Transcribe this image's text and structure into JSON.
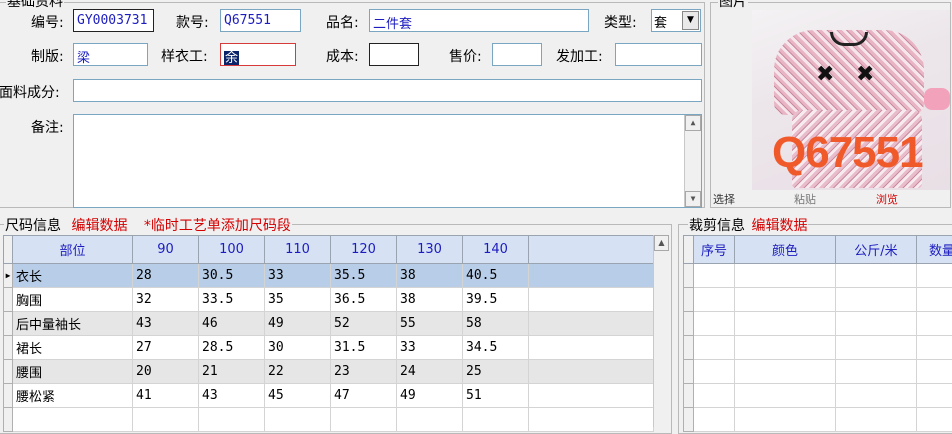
{
  "basic": {
    "section_title": "基础资料",
    "code_label": "编号:",
    "code_value": "GY0003731",
    "style_label": "款号:",
    "style_value": "Q67551",
    "name_label": "品名:",
    "name_value": "二件套",
    "type_label": "类型:",
    "type_value": "套",
    "pattern_label": "制版:",
    "pattern_value": "梁",
    "sample_label": "样衣工:",
    "sample_value": "余",
    "cost_label": "成本:",
    "cost_value": "",
    "price_label": "售价:",
    "price_value": "",
    "outsource_label": "发加工:",
    "outsource_value": "",
    "fabric_label": "面料成分:",
    "fabric_value": "",
    "remark_label": "备注:",
    "remark_value": ""
  },
  "image": {
    "section_title": "图片",
    "overlay_text": "Q67551",
    "btn_select": "选择",
    "btn_paste": "粘贴",
    "btn_browse": "浏览"
  },
  "size": {
    "title": "尺码信息",
    "edit_link": "编辑数据",
    "hint": "*临时工艺单添加尺码段",
    "headers": [
      "部位",
      "90",
      "100",
      "110",
      "120",
      "130",
      "140"
    ],
    "rows": [
      [
        "衣长",
        "28",
        "30.5",
        "33",
        "35.5",
        "38",
        "40.5"
      ],
      [
        "胸围",
        "32",
        "33.5",
        "35",
        "36.5",
        "38",
        "39.5"
      ],
      [
        "后中量袖长",
        "43",
        "46",
        "49",
        "52",
        "55",
        "58"
      ],
      [
        "裙长",
        "27",
        "28.5",
        "30",
        "31.5",
        "33",
        "34.5"
      ],
      [
        "腰围",
        "20",
        "21",
        "22",
        "23",
        "24",
        "25"
      ],
      [
        "腰松紧",
        "41",
        "43",
        "45",
        "47",
        "49",
        "51"
      ]
    ]
  },
  "cut": {
    "title": "裁剪信息",
    "edit_link": "编辑数据",
    "headers": [
      "序号",
      "颜色",
      "公斤/米",
      "数量"
    ]
  },
  "colors": {
    "accent_red": "#d40000",
    "field_text": "#1d1dbf",
    "header_bg": "#d6e2f3",
    "selected_row": "#b7cde8"
  }
}
